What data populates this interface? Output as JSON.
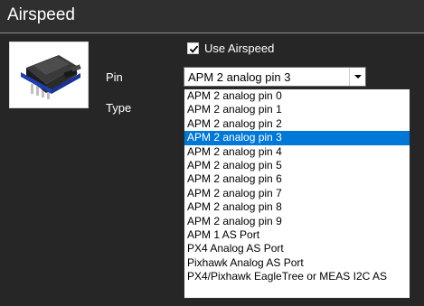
{
  "section": {
    "title": "Airspeed"
  },
  "sensor_image": {
    "icon": "airspeed-sensor-icon"
  },
  "use_airspeed": {
    "label": "Use Airspeed",
    "checked": true
  },
  "pin": {
    "label": "Pin",
    "selected_value": "APM 2 analog pin 3"
  },
  "type": {
    "label": "Type"
  },
  "dropdown": {
    "options": [
      "APM 2 analog pin 0",
      "APM 2 analog pin 1",
      "APM 2 analog pin 2",
      "APM 2 analog pin 3",
      "APM 2 analog pin 4",
      "APM 2 analog pin 5",
      "APM 2 analog pin 6",
      "APM 2 analog pin 7",
      "APM 2 analog pin 8",
      "APM 2 analog pin 9",
      "APM 1 AS Port",
      "PX4 Analog AS Port",
      "Pixhawk Analog AS Port",
      "PX4/Pixhawk EagleTree or MEAS I2C AS"
    ],
    "selected_index": 3
  },
  "colors": {
    "background": "#262626",
    "header": "#2f2f2f",
    "selection": "#0078d7"
  }
}
